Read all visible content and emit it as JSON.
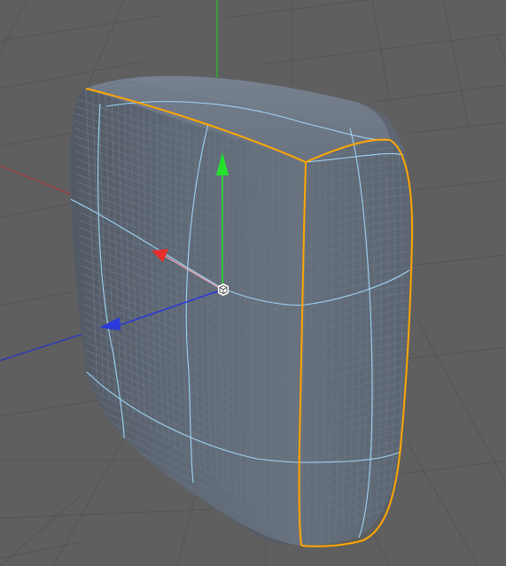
{
  "viewport": {
    "view": "perspective",
    "background_color": "#5f5f5f",
    "grid_color": "#545454",
    "grid_visible": true
  },
  "object": {
    "type": "rounded-cube subdivision mesh",
    "surface_color": "#5b6470",
    "wire_color": "#6d7784",
    "cage_edge_color": "#9fd4f5",
    "selected_edge_color": "#ffa600"
  },
  "gizmo": {
    "mode": "move",
    "x_axis_color": "#e62e2e",
    "y_axis_color": "#22e22e",
    "z_axis_color": "#2a3ad8",
    "pivot_icon": "cube-pivot-icon"
  }
}
